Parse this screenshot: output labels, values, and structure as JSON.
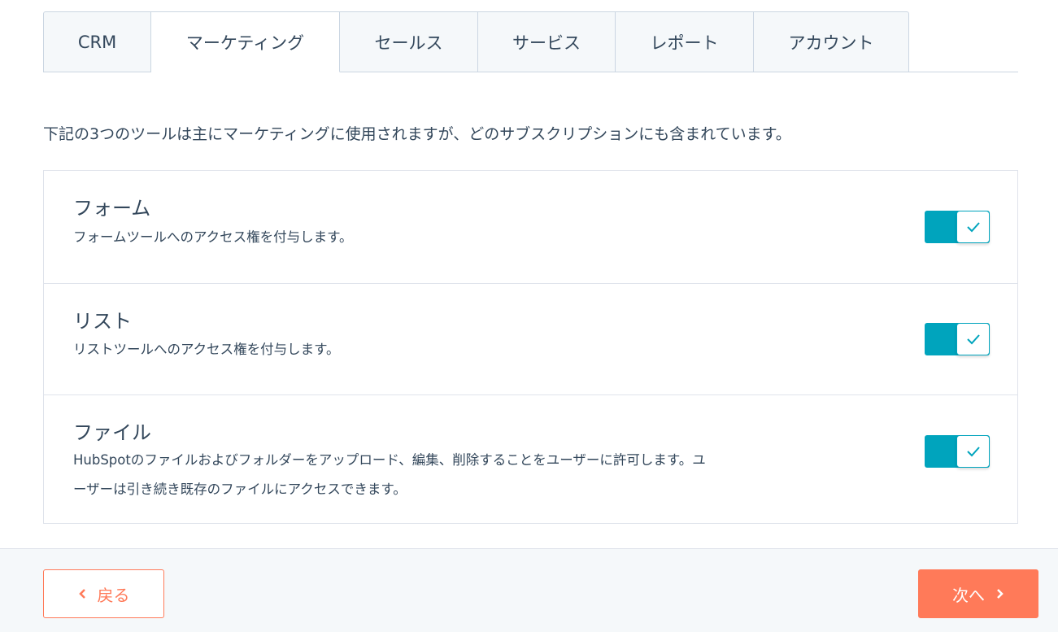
{
  "tabs": [
    {
      "label": "CRM",
      "active": false
    },
    {
      "label": "マーケティング",
      "active": true
    },
    {
      "label": "セールス",
      "active": false
    },
    {
      "label": "サービス",
      "active": false
    },
    {
      "label": "レポート",
      "active": false
    },
    {
      "label": "アカウント",
      "active": false
    }
  ],
  "intro_text": "下記の3つのツールは主にマーケティングに使用されますが、どのサブスクリプションにも含まれています。",
  "tools": [
    {
      "title": "フォーム",
      "description": "フォームツールへのアクセス権を付与します。",
      "enabled": true
    },
    {
      "title": "リスト",
      "description": "リストツールへのアクセス権を付与します。",
      "enabled": true
    },
    {
      "title": "ファイル",
      "description": "HubSpotのファイルおよびフォルダーをアップロード、編集、削除することをユーザーに許可します。ユーザーは引き続き既存のファイルにアクセスできます。",
      "enabled": true
    }
  ],
  "footer": {
    "back_label": "戻る",
    "next_label": "次へ"
  },
  "colors": {
    "accent_teal": "#00a4bd",
    "primary_orange": "#ff7a59",
    "text": "#33475b",
    "border": "#cbd6e2"
  },
  "icons": {
    "toggle_check": "check-icon",
    "back": "chevron-left-icon",
    "next": "chevron-right-icon"
  }
}
